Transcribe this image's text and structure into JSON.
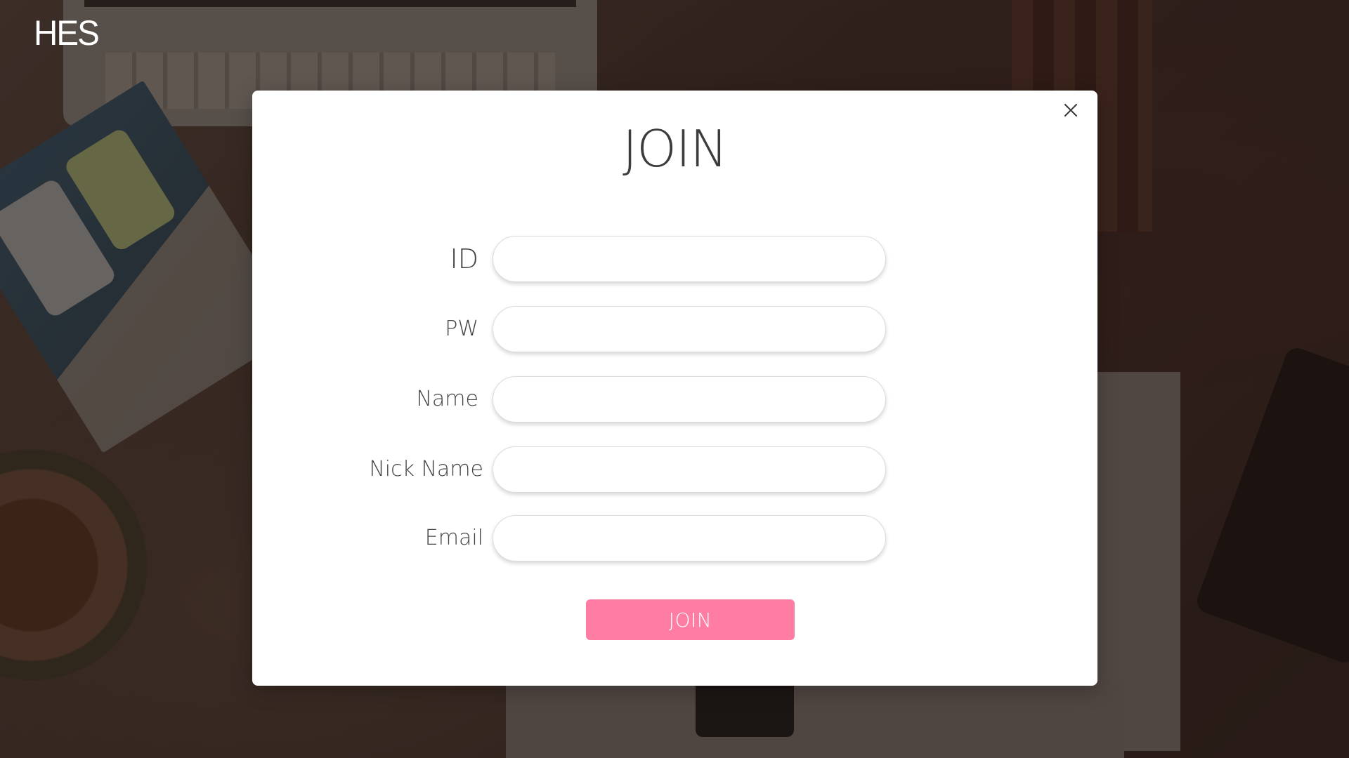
{
  "logo": {
    "text": "HES"
  },
  "modal": {
    "title": "JOIN",
    "close_icon": "close-icon",
    "fields": {
      "id": {
        "label": "ID",
        "value": "",
        "placeholder": ""
      },
      "pw": {
        "label": "PW",
        "value": "",
        "placeholder": ""
      },
      "name": {
        "label": "Name",
        "value": "",
        "placeholder": ""
      },
      "nick_name": {
        "label": "Nick Name",
        "value": "",
        "placeholder": ""
      },
      "email": {
        "label": "Email",
        "value": "",
        "placeholder": ""
      }
    },
    "submit_label": "JOIN"
  },
  "colors": {
    "accent": "#ff7da3",
    "modal_bg": "#ffffff",
    "text": "#444444",
    "logo": "#ffffff"
  }
}
